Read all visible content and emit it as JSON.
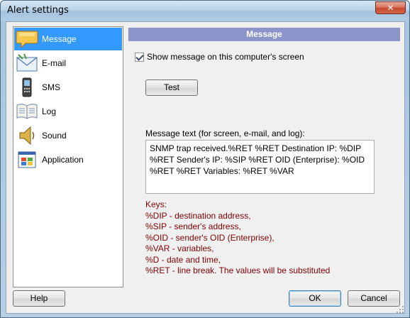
{
  "window": {
    "title": "Alert settings",
    "close_label": "✕"
  },
  "sidebar": {
    "items": [
      {
        "label": "Message",
        "icon": "speech-bubble-icon",
        "selected": true
      },
      {
        "label": "E-mail",
        "icon": "envelope-icon",
        "selected": false
      },
      {
        "label": "SMS",
        "icon": "mobile-phone-icon",
        "selected": false
      },
      {
        "label": "Log",
        "icon": "log-book-icon",
        "selected": false
      },
      {
        "label": "Sound",
        "icon": "speaker-icon",
        "selected": false
      },
      {
        "label": "Application",
        "icon": "application-window-icon",
        "selected": false
      }
    ]
  },
  "panel": {
    "header": "Message",
    "show_message_label": "Show message on this computer's screen",
    "show_message_checked": true,
    "test_label": "Test",
    "message_label": "Message text (for screen, e-mail, and log):",
    "message_value": "SNMP trap received.%RET %RET Destination IP: %DIP %RET Sender's IP: %SIP %RET OID (Enterprise): %OID %RET %RET Variables: %RET %VAR",
    "keys": [
      "Keys:",
      "%DIP - destination address,",
      "%SIP - sender's address,",
      "%OID - sender's OID (Enterprise),",
      "%VAR - variables,",
      "%D - date and time,",
      "%RET - line break. The values will be substituted"
    ]
  },
  "footer": {
    "help_label": "Help",
    "ok_label": "OK",
    "cancel_label": "Cancel"
  },
  "colors": {
    "header_bar": "#8b95c9",
    "selection": "#3399ff",
    "keys_text": "#800000"
  }
}
